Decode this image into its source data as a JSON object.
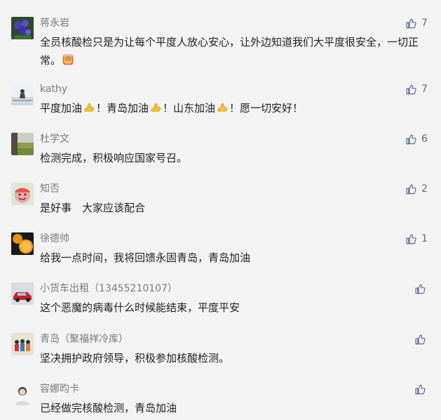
{
  "comments": [
    {
      "name": "蒋永岩",
      "likes": "7",
      "avatar_icon": "purple-flower-avatar",
      "text_parts": [
        "全员核酸检只是为让每个平度人放心安心，让外边知道我们大平度很安全，一切正常。"
      ],
      "emoji": "fist-emoji"
    },
    {
      "name": "kathy",
      "likes": "7",
      "avatar_icon": "seaside-person-avatar",
      "text_parts": [
        "平度加油",
        "！青岛加油",
        "！山东加油",
        "！愿一切安好！"
      ],
      "emoji": "flexed-biceps-emoji"
    },
    {
      "name": "杜学文",
      "likes": "6",
      "avatar_icon": "field-landscape-avatar",
      "text_parts": [
        "检测完成，积极响应国家号召。"
      ]
    },
    {
      "name": "知否",
      "likes": "2",
      "avatar_icon": "cartoon-face-avatar",
      "text_parts": [
        "是好事　大家应该配合"
      ]
    },
    {
      "name": "徐德帅",
      "likes": "1",
      "avatar_icon": "orange-slices-avatar",
      "text_parts": [
        "给我一点时间，我将回馈永固青岛，青岛加油"
      ]
    },
    {
      "name": "小货车出租（13455210107）",
      "likes": "",
      "avatar_icon": "red-car-avatar",
      "text_parts": [
        "这个恶魔的病毒什么时候能结束，平度平安"
      ]
    },
    {
      "name": "青岛（聚福祥冷库）",
      "likes": "",
      "avatar_icon": "group-photo-avatar",
      "text_parts": [
        "坚决拥护政府领导，积极参加核酸检测。"
      ]
    },
    {
      "name": "容娜昀卡",
      "likes": "",
      "avatar_icon": "portrait-avatar",
      "text_parts": [
        "已经做完核酸检测，青岛加油"
      ]
    }
  ],
  "colors": {
    "background": "#f3f3f3",
    "like_icon": "#576b95",
    "name": "#7b7b7b",
    "text": "#1f1f1f"
  }
}
